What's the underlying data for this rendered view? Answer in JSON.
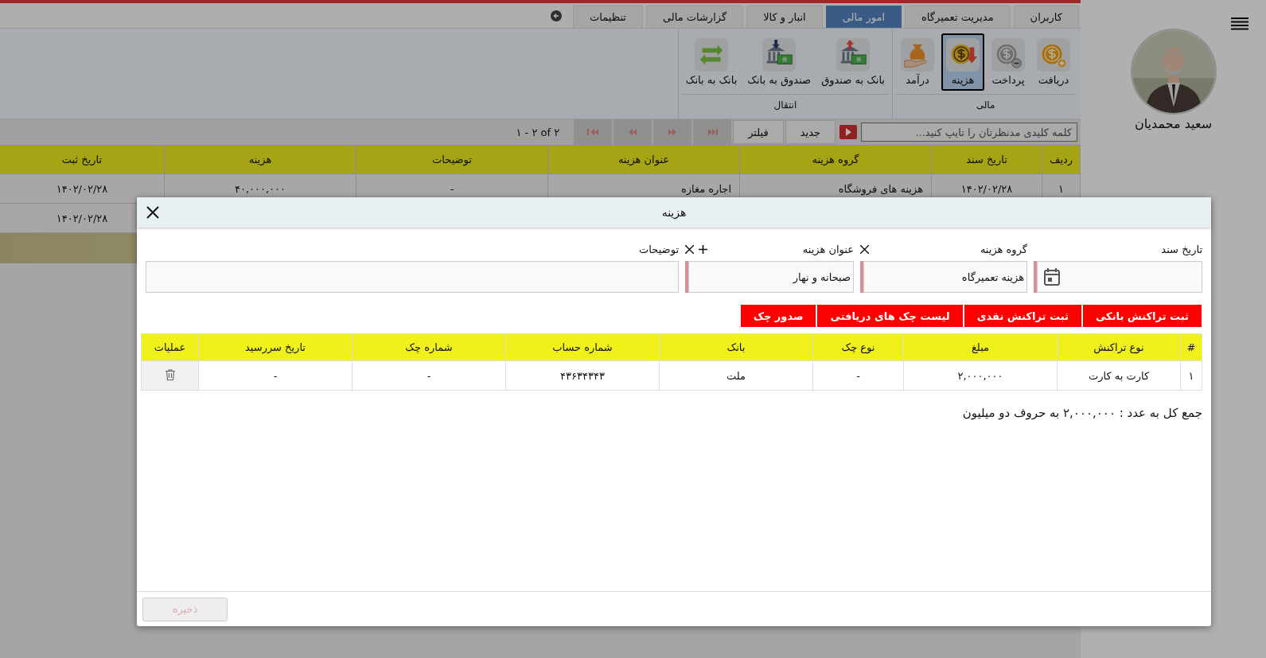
{
  "sidebar": {
    "user_name": "سعید محمدیان"
  },
  "tabs": [
    {
      "label": "کاربران",
      "selected": false
    },
    {
      "label": "مدیریت تعمیرگاه",
      "selected": false
    },
    {
      "label": "امور مالی",
      "selected": true
    },
    {
      "label": "انبار و کالا",
      "selected": false
    },
    {
      "label": "گزارشات مالی",
      "selected": false
    },
    {
      "label": "تنظیمات",
      "selected": false
    }
  ],
  "ribbon": {
    "groups": [
      {
        "label": "مالی",
        "items": [
          {
            "label": "دریافت",
            "kind": "receive",
            "selected": false
          },
          {
            "label": "پرداخت",
            "kind": "pay",
            "selected": false
          },
          {
            "label": "هزینه",
            "kind": "expense",
            "selected": true
          },
          {
            "label": "درآمد",
            "kind": "income",
            "selected": false
          }
        ]
      },
      {
        "label": "انتقال",
        "items": [
          {
            "label": "بانک به صندوق",
            "kind": "bank_to_cash",
            "selected": false
          },
          {
            "label": "صندوق به بانک",
            "kind": "cash_to_bank",
            "selected": false
          },
          {
            "label": "بانک به بانک",
            "kind": "bank_to_bank",
            "selected": false
          }
        ]
      }
    ]
  },
  "toolbar": {
    "search": {
      "placeholder": "کلمه کلیدی مدنظرتان را تایپ کنید..."
    },
    "buttons": [
      "جدید",
      "فیلتر"
    ],
    "pager_summary": "۱ - ۲ of ۲"
  },
  "table": {
    "columns": [
      "ردیف",
      "تاریخ سند",
      "گروه هزینه",
      "عنوان هزینه",
      "توضیحات",
      "هزینه",
      "تاریخ ثبت"
    ],
    "rows": [
      [
        "۱",
        "۱۴۰۲/۰۲/۲۸",
        "هزینه های فروشگاه",
        "اجاره مغازه",
        "-",
        "۴۰,۰۰۰,۰۰۰",
        "۱۴۰۲/۰۲/۲۸"
      ],
      [
        null,
        null,
        null,
        null,
        null,
        null,
        "۱۴۰۲/۰۲/۲۸"
      ]
    ]
  },
  "dialog": {
    "title": "هزینه",
    "fields": [
      {
        "label": "تاریخ سند",
        "kind": "date",
        "required": true,
        "clearable": false,
        "addable": false
      },
      {
        "label": "گروه هزینه",
        "kind": "text",
        "value": "هزینه تعمیرگاه",
        "required": true,
        "clearable": true,
        "addable": false
      },
      {
        "label": "عنوان هزینه",
        "kind": "text",
        "value": "صبحانه و نهار",
        "required": true,
        "clearable": true,
        "addable": true
      },
      {
        "label": "توضیحات",
        "kind": "text",
        "required": false,
        "clearable": false,
        "addable": false
      }
    ],
    "actions": [
      "ثبت تراکنش بانکی",
      "ثبت تراکنش نقدی",
      "لیست چک های دریافتی",
      "صدور چک"
    ],
    "table": {
      "columns": [
        "#",
        "نوع تراکنش",
        "مبلغ",
        "نوع چک",
        "بانک",
        "شماره حساب",
        "شماره چک",
        "تاریخ سررسید",
        "عملیات"
      ],
      "rows": [
        [
          "۱",
          "کارت به کارت",
          "۲,۰۰۰,۰۰۰",
          "-",
          "ملت",
          "۴۳۶۳۴۳۴۳",
          "-",
          "-"
        ]
      ]
    },
    "total": "جمع کل به عدد : ۲,۰۰۰,۰۰۰ به حروف دو میلیون",
    "save": {
      "label": "ذخیره",
      "disabled": true
    }
  }
}
